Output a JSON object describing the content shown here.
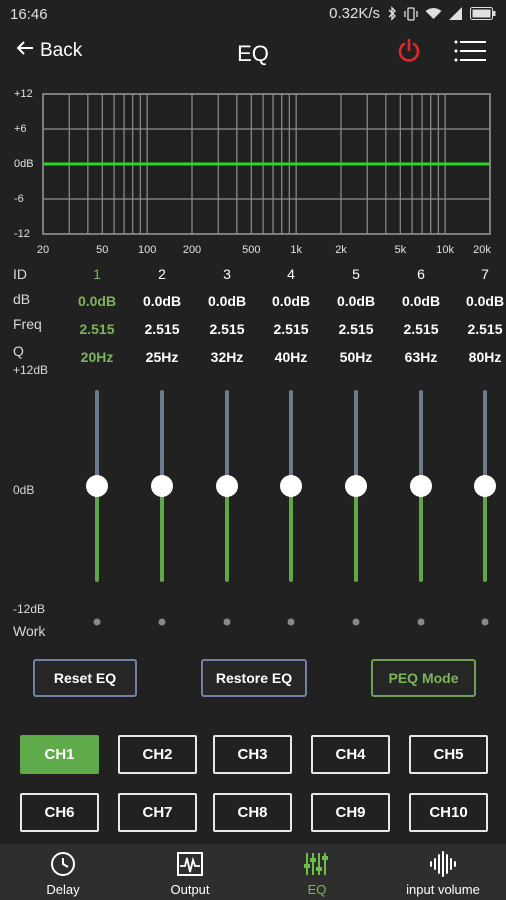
{
  "status_bar": {
    "time": "16:46",
    "net_speed": "0.32K/s",
    "icons": [
      "bluetooth-icon",
      "vibrate-icon",
      "wifi-icon",
      "cell-signal-icon",
      "battery-icon"
    ]
  },
  "header": {
    "back_label": "Back",
    "title": "EQ",
    "power_icon": "power-icon",
    "menu_icon": "menu-icon",
    "power_color": "#e0262a"
  },
  "graph": {
    "y_ticks": [
      "+12",
      "+6",
      "0dB",
      "-6",
      "-12"
    ],
    "x_ticks": [
      "20",
      "50",
      "100",
      "200",
      "500",
      "1k",
      "2k",
      "5k",
      "10k",
      "20k"
    ],
    "curve_db": 0,
    "curve_color": "#2bd62b"
  },
  "row_labels": {
    "id": "ID",
    "db": "dB",
    "freq": "Freq",
    "q": "Q",
    "top": "+12dB",
    "mid": "0dB",
    "bottom": "-12dB",
    "work": "Work"
  },
  "bands": [
    {
      "id": "1",
      "db": "0.0dB",
      "freq": "2.515",
      "q": "20Hz",
      "active": true,
      "level_db": 0
    },
    {
      "id": "2",
      "db": "0.0dB",
      "freq": "2.515",
      "q": "25Hz",
      "active": false,
      "level_db": 0
    },
    {
      "id": "3",
      "db": "0.0dB",
      "freq": "2.515",
      "q": "32Hz",
      "active": false,
      "level_db": 0
    },
    {
      "id": "4",
      "db": "0.0dB",
      "freq": "2.515",
      "q": "40Hz",
      "active": false,
      "level_db": 0
    },
    {
      "id": "5",
      "db": "0.0dB",
      "freq": "2.515",
      "q": "50Hz",
      "active": false,
      "level_db": 0
    },
    {
      "id": "6",
      "db": "0.0dB",
      "freq": "2.515",
      "q": "63Hz",
      "active": false,
      "level_db": 0
    },
    {
      "id": "7",
      "db": "0.0dB",
      "freq": "2.515",
      "q": "80Hz",
      "active": false,
      "level_db": 0
    }
  ],
  "buttons": {
    "reset": "Reset EQ",
    "restore": "Restore EQ",
    "peq": "PEQ Mode"
  },
  "channels": [
    "CH1",
    "CH2",
    "CH3",
    "CH4",
    "CH5",
    "CH6",
    "CH7",
    "CH8",
    "CH9",
    "CH10"
  ],
  "selected_channel": "CH1",
  "nav": [
    {
      "label": "Delay",
      "icon": "clock-icon",
      "active": false
    },
    {
      "label": "Output",
      "icon": "waveform-icon",
      "active": false
    },
    {
      "label": "EQ",
      "icon": "equalizer-icon",
      "active": true
    },
    {
      "label": "input volume",
      "icon": "audio-wave-icon",
      "active": false
    }
  ],
  "colors": {
    "accent_green": "#5faa4a",
    "active_text": "#7cb55a",
    "peq_border": "#6ea055"
  }
}
